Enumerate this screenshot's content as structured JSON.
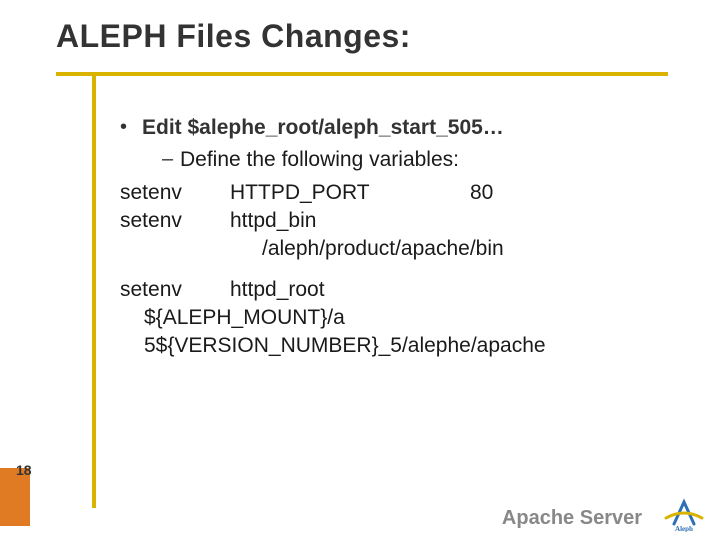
{
  "title": "ALEPH Files Changes:",
  "page_number": "18",
  "footer": "Apache Server",
  "logo_name": "aleph-logo",
  "bullet": {
    "label": "Edit $alephe_root/aleph_start_505…",
    "sub": "Define the following variables:"
  },
  "env": {
    "rows": [
      {
        "cmd": "setenv",
        "var": "HTTPD_PORT",
        "val": "80"
      },
      {
        "cmd": "setenv",
        "var": "httpd_bin",
        "val": "/aleph/product/apache/bin"
      },
      {
        "cmd": "setenv",
        "var": "httpd_root",
        "val": "${ALEPH_MOUNT}/a 5${VERSION_NUMBER}_5/alephe/apache"
      }
    ]
  }
}
